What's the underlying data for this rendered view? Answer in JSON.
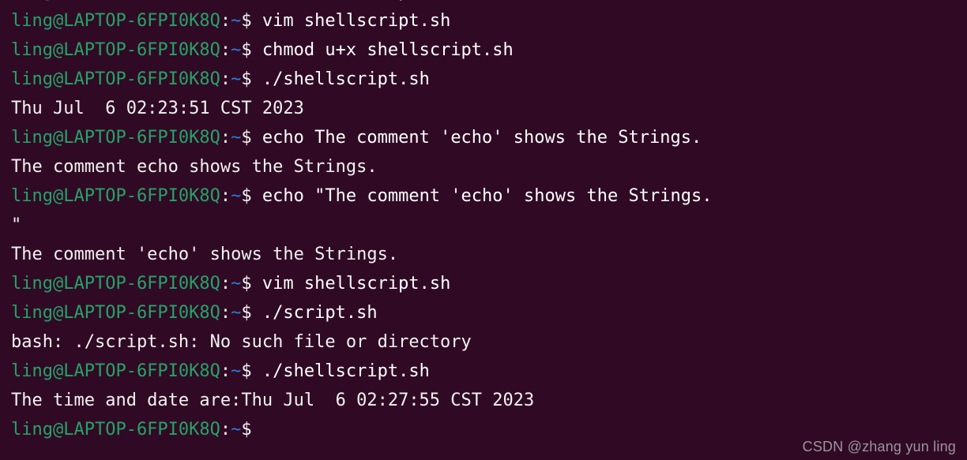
{
  "terminal": {
    "shell": "bash",
    "colors": {
      "background": "#300A24",
      "prompt_user_host": "#26A269",
      "prompt_path": "#2A7BDE",
      "foreground": "#F2F2F2",
      "watermark": "#9E939C"
    },
    "prompt": {
      "user_host": "ling@LAPTOP-6FPI0K8Q",
      "colon": ":",
      "path": "~",
      "dollar": "$",
      "space": " "
    },
    "lines": [
      {
        "type": "command",
        "command": "vim shellscript.sh"
      },
      {
        "type": "command",
        "command": "vim shellscript.sh"
      },
      {
        "type": "command",
        "command": "chmod u+x shellscript.sh"
      },
      {
        "type": "command",
        "command": "./shellscript.sh"
      },
      {
        "type": "output",
        "text": "Thu Jul  6 02:23:51 CST 2023"
      },
      {
        "type": "command",
        "command": "echo The comment 'echo' shows the Strings."
      },
      {
        "type": "output",
        "text": "The comment echo shows the Strings."
      },
      {
        "type": "command",
        "command": "echo \"The comment 'echo' shows the Strings."
      },
      {
        "type": "output",
        "text": "\""
      },
      {
        "type": "output",
        "text": "The comment 'echo' shows the Strings."
      },
      {
        "type": "command",
        "command": "vim shellscript.sh"
      },
      {
        "type": "command",
        "command": "./script.sh"
      },
      {
        "type": "output",
        "text": "bash: ./script.sh: No such file or directory"
      },
      {
        "type": "command",
        "command": "./shellscript.sh"
      },
      {
        "type": "output",
        "text": "The time and date are:Thu Jul  6 02:27:55 CST 2023"
      },
      {
        "type": "command",
        "command": ""
      }
    ]
  },
  "watermark": {
    "text": "CSDN @zhang yun ling"
  }
}
